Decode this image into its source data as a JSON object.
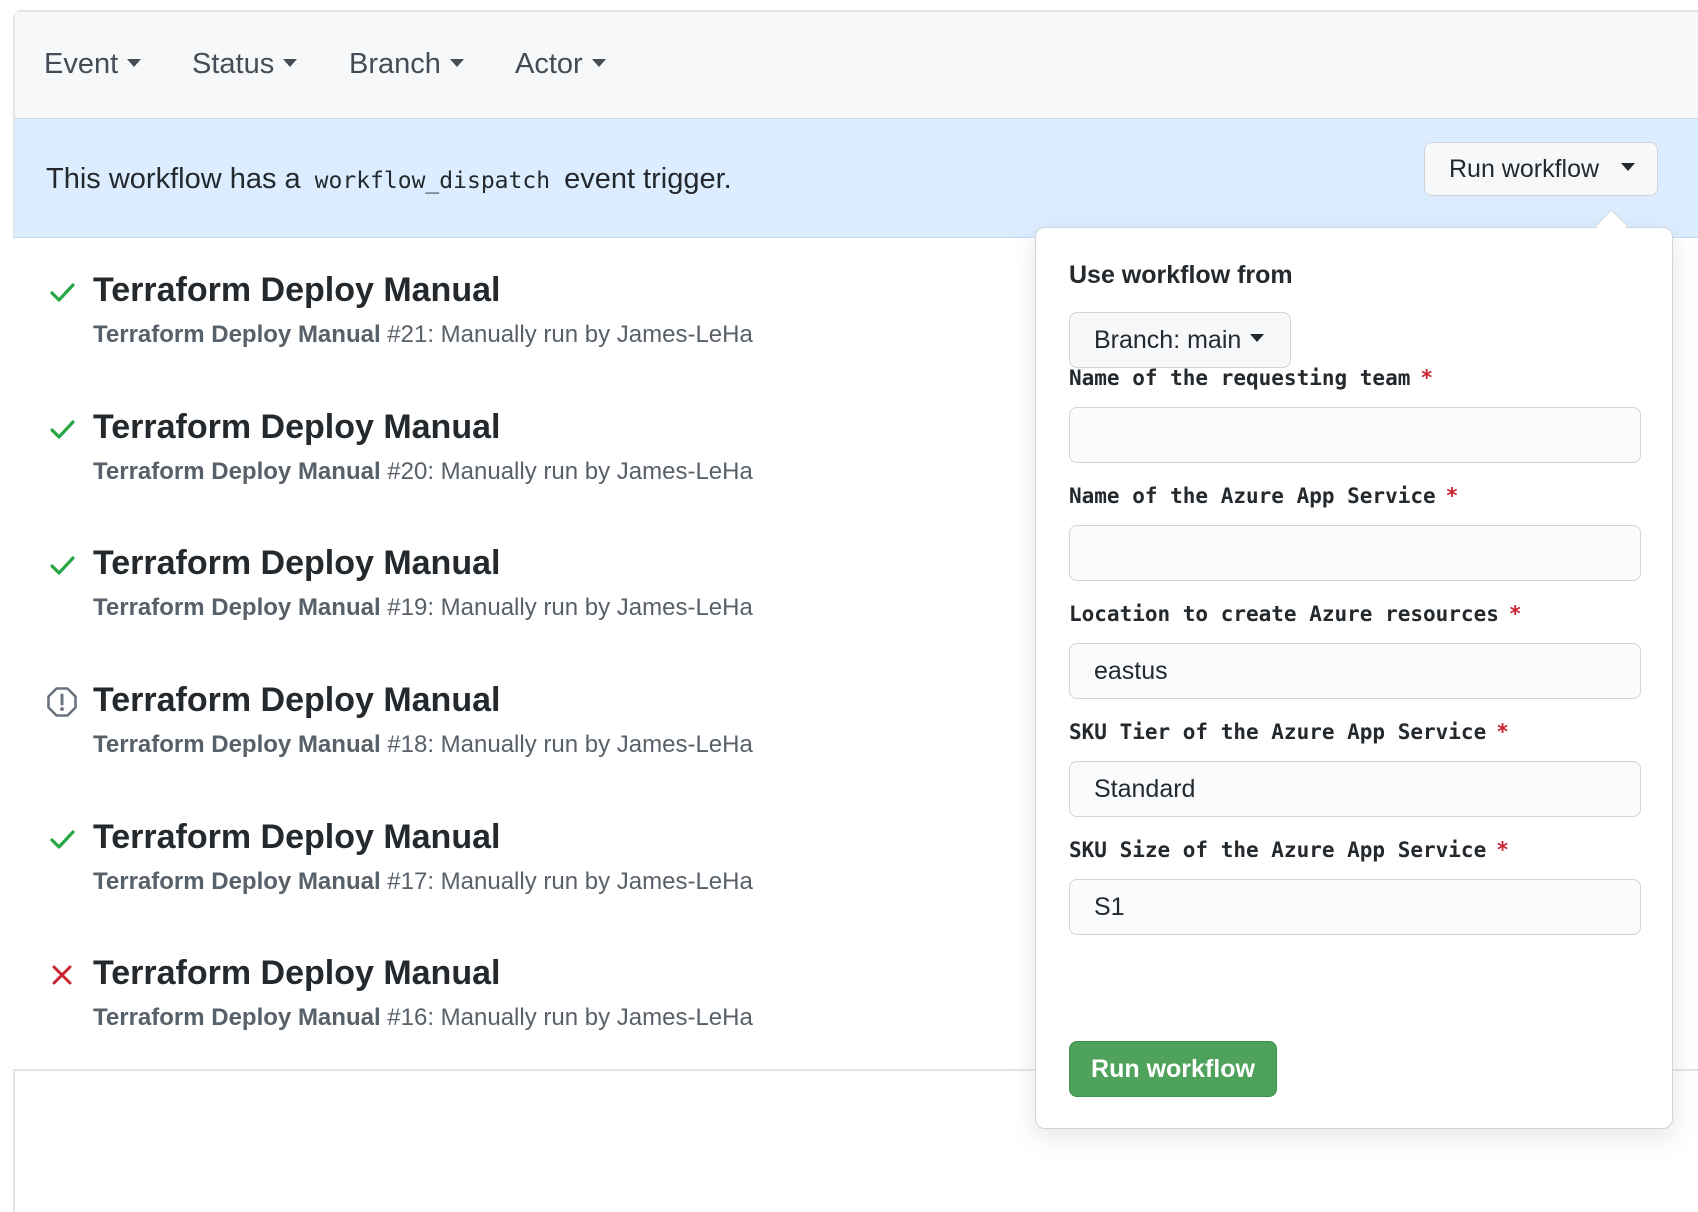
{
  "filters": [
    "Event",
    "Status",
    "Branch",
    "Actor"
  ],
  "banner": {
    "prefix": "This workflow has a",
    "code": "workflow_dispatch",
    "suffix": "event trigger.",
    "button_label": "Run workflow"
  },
  "runs": [
    {
      "status": "success",
      "title": "Terraform Deploy Manual",
      "workflow": "Terraform Deploy Manual",
      "detail": "#21: Manually run by James-LeHa"
    },
    {
      "status": "success",
      "title": "Terraform Deploy Manual",
      "workflow": "Terraform Deploy Manual",
      "detail": "#20: Manually run by James-LeHa"
    },
    {
      "status": "success",
      "title": "Terraform Deploy Manual",
      "workflow": "Terraform Deploy Manual",
      "detail": "#19: Manually run by James-LeHa"
    },
    {
      "status": "cancelled",
      "title": "Terraform Deploy Manual",
      "workflow": "Terraform Deploy Manual",
      "detail": "#18: Manually run by James-LeHa"
    },
    {
      "status": "success",
      "title": "Terraform Deploy Manual",
      "workflow": "Terraform Deploy Manual",
      "detail": "#17: Manually run by James-LeHa"
    },
    {
      "status": "failure",
      "title": "Terraform Deploy Manual",
      "workflow": "Terraform Deploy Manual",
      "detail": "#16: Manually run by James-LeHa"
    }
  ],
  "popover": {
    "heading": "Use workflow from",
    "branch_label": "Branch: main",
    "fields": [
      {
        "label": "Name of the requesting team",
        "required_mark": "*",
        "value": ""
      },
      {
        "label": "Name of the Azure App Service",
        "required_mark": "*",
        "value": ""
      },
      {
        "label": "Location to create Azure resources",
        "required_mark": "*",
        "value": "eastus"
      },
      {
        "label": "SKU Tier of the Azure App Service",
        "required_mark": "*",
        "value": "Standard"
      },
      {
        "label": "SKU Size of the Azure App Service",
        "required_mark": "*",
        "value": "S1"
      }
    ],
    "submit_label": "Run workflow"
  },
  "colors": {
    "success": "#28a745",
    "failure": "#cb2431",
    "cancelled": "#6a737d",
    "banner_bg": "#dbedff",
    "submit_bg": "#4fa25c"
  },
  "icons": {
    "success": "check-icon",
    "failure": "x-icon",
    "cancelled": "stop-icon",
    "dropdown": "caret-down-icon"
  }
}
